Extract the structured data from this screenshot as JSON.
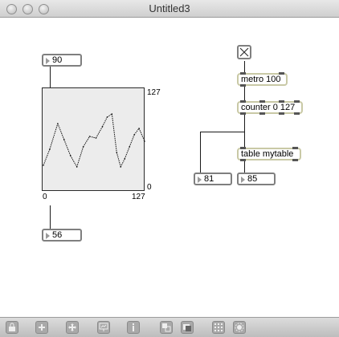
{
  "window": {
    "title": "Untitled3"
  },
  "patch": {
    "numbox_top": "90",
    "numbox_bottom": "56",
    "numbox_left": "81",
    "numbox_right": "85",
    "metro": "metro 100",
    "counter": "counter 0 127",
    "table_obj": "table mytable",
    "table_view": {
      "y_max": "127",
      "y_min": "0",
      "x_min": "0",
      "x_max": "127"
    }
  },
  "toolbar": {
    "items": [
      "lock-icon",
      "add-icon",
      "move-icon",
      "presentation-icon",
      "inspector-icon",
      "subpatch-icon",
      "window-icon",
      "grid-icon",
      "settings-icon"
    ]
  },
  "chart_data": {
    "type": "line",
    "x": [
      0,
      8,
      18,
      26,
      34,
      42,
      50,
      58,
      66,
      74,
      80,
      86,
      92,
      97,
      102,
      108,
      114,
      120,
      127
    ],
    "values": [
      32,
      52,
      84,
      64,
      44,
      30,
      55,
      68,
      66,
      80,
      92,
      96,
      48,
      30,
      40,
      55,
      70,
      78,
      62
    ],
    "xlim": [
      0,
      127
    ],
    "ylim": [
      0,
      127
    ]
  }
}
